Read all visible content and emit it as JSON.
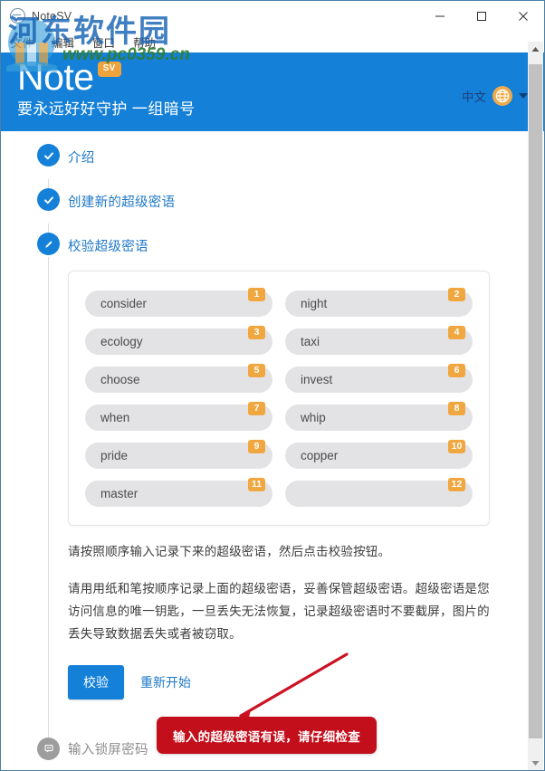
{
  "window": {
    "app_title": "NoteSV",
    "app_icon": "notesv-app-icon",
    "minimize_icon": "minimize-icon",
    "maximize_icon": "maximize-icon",
    "close_icon": "close-icon"
  },
  "menubar": {
    "items": [
      {
        "label": "文件"
      },
      {
        "label": "编辑"
      },
      {
        "label": "窗口"
      },
      {
        "label": "帮助"
      }
    ]
  },
  "header": {
    "brand_name": "Note",
    "brand_badge": "SV",
    "subtitle": "要永远好好守护 一组暗号",
    "language": "中文",
    "globe_icon": "globe-icon",
    "caret_icon": "chevron-down-icon",
    "background_color": "#1480d8",
    "badge_color": "#efa33c"
  },
  "steps": [
    {
      "label": "介绍",
      "state": "done",
      "icon": "check-icon"
    },
    {
      "label": "创建新的超级密语",
      "state": "done",
      "icon": "check-icon"
    },
    {
      "label": "校验超级密语",
      "state": "current",
      "icon": "pencil-icon"
    },
    {
      "label": "输入锁屏密码",
      "state": "pending",
      "icon": "lock-keypad-icon"
    }
  ],
  "seed_panel": {
    "words": [
      {
        "index": "1",
        "word": "consider"
      },
      {
        "index": "2",
        "word": "night"
      },
      {
        "index": "3",
        "word": "ecology"
      },
      {
        "index": "4",
        "word": "taxi"
      },
      {
        "index": "5",
        "word": "choose"
      },
      {
        "index": "6",
        "word": "invest"
      },
      {
        "index": "7",
        "word": "when"
      },
      {
        "index": "8",
        "word": "whip"
      },
      {
        "index": "9",
        "word": "pride"
      },
      {
        "index": "10",
        "word": "copper"
      },
      {
        "index": "11",
        "word": "master"
      },
      {
        "index": "12",
        "word": ""
      }
    ],
    "badge_color": "#f0a740",
    "pill_color": "#e3e3e5"
  },
  "body_text": {
    "paragraph_1": "请按照顺序输入记录下来的超级密语，然后点击校验按钮。",
    "paragraph_2": "请用用纸和笔按顺序记录上面的超级密语，妥善保管超级密语。超级密语是您访问信息的唯一钥匙，一旦丢失无法恢复，记录超级密语时不要截屏，图片的丢失导致数据丢失或者被窃取。"
  },
  "actions": {
    "verify_label": "校验",
    "restart_label": "重新开始",
    "primary_color": "#1480d8",
    "link_color": "#1f78c8"
  },
  "toast": {
    "message": "输入的超级密语有误，请仔细检查",
    "color": "#c30f1c"
  },
  "annotation": {
    "arrow_icon": "red-arrow-annotation",
    "color": "#cc1122"
  },
  "scrollbar": {
    "up_arrow_icon": "scroll-up-arrow-icon",
    "down_arrow_icon": "scroll-down-arrow-icon",
    "thumb_name": "scroll-thumb"
  },
  "watermark": {
    "text": "河东软件园",
    "url": "www.pc0359.cn"
  }
}
